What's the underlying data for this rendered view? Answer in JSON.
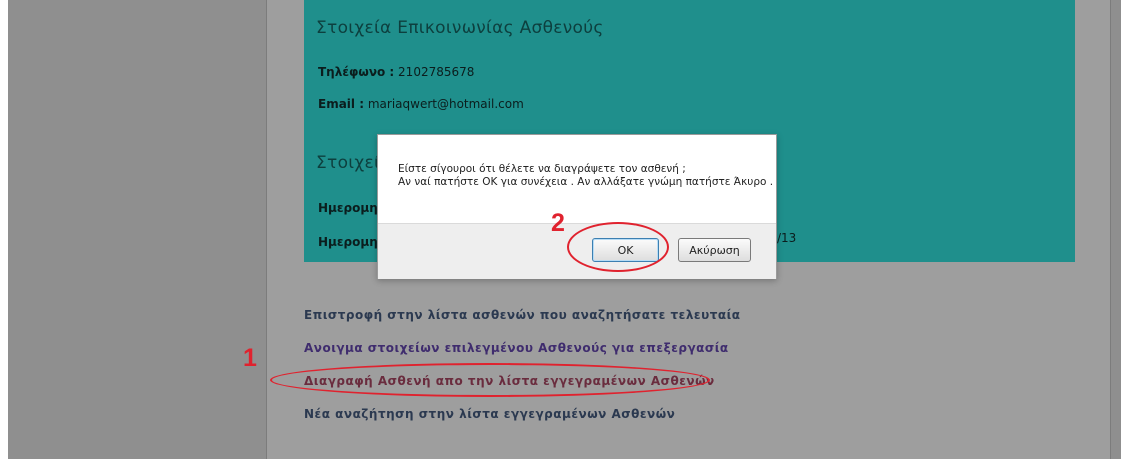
{
  "contact": {
    "title": "Στοιχεία Επικοινωνίας Ασθενούς",
    "phone_label": "Τηλέφωνο :",
    "phone_value": "2102785678",
    "email_label": "Email :",
    "email_value": "mariaqwert@hotmail.com"
  },
  "dates": {
    "title_partial": "Στοιχεί",
    "row1_label_partial": "Ημερομη",
    "row2_label_partial": "Ημερομη",
    "row2_value_partial": "/13"
  },
  "links": {
    "back": "Επιστροφή στην λίστα ασθενών που αναζητήσατε τελευταία",
    "open": "Ανοιγμα στοιχείων επιλεγμένου Ασθενούς για επεξεργασία",
    "delete": "Διαγραφή Ασθενή απο την λίστα εγγεγραμένων Ασθενών",
    "new_search": "Νέα αναζήτηση στην λίστα εγγεγραμένων Ασθενών"
  },
  "dialog": {
    "line1": "Είστε σίγουροι ότι θέλετε να διαγράψετε τον ασθενή ;",
    "line2": "Αν ναί πατήστε ΟΚ για συνέχεια . Αν αλλάξατε γνώμη πατήστε Άκυρο .",
    "ok_label": "OK",
    "cancel_label": "Ακύρωση"
  },
  "annotations": {
    "step1": "1",
    "step2": "2",
    "color": "#e0222e"
  },
  "colors": {
    "panel": "#1f8f8c",
    "overlay_bg": "#9e9e9e"
  }
}
